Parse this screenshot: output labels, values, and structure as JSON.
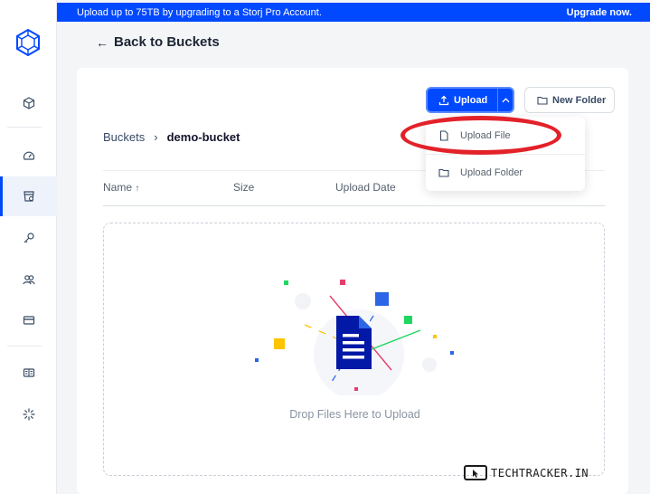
{
  "banner": {
    "message": "Upload up to 75TB by upgrading to a Storj Pro Account.",
    "cta": "Upgrade now."
  },
  "nav": {
    "back_label": "Back to Buckets"
  },
  "sidebar": {
    "logo": "storj-logo-icon",
    "items": [
      {
        "name": "dashboard",
        "icon": "cube-icon"
      },
      {
        "name": "usage",
        "icon": "gauge-icon"
      },
      {
        "name": "buckets",
        "icon": "bucket-icon",
        "active": true
      },
      {
        "name": "access",
        "icon": "key-icon"
      },
      {
        "name": "team",
        "icon": "users-icon"
      },
      {
        "name": "billing",
        "icon": "card-icon"
      },
      {
        "name": "resources",
        "icon": "book-icon"
      },
      {
        "name": "settings",
        "icon": "spark-icon"
      }
    ]
  },
  "toolbar": {
    "upload_label": "Upload",
    "new_folder_label": "New Folder"
  },
  "breadcrumb": {
    "root": "Buckets",
    "separator": "›",
    "current": "demo-bucket"
  },
  "upload_menu": {
    "items": [
      {
        "label": "Upload File",
        "icon": "file-icon"
      },
      {
        "label": "Upload Folder",
        "icon": "folder-icon"
      }
    ]
  },
  "table": {
    "columns": [
      "Name",
      "Size",
      "Upload Date"
    ],
    "sort_indicator": "↑"
  },
  "dropzone": {
    "text": "Drop Files Here to Upload"
  },
  "watermark": {
    "text": "TECHTRACKER.IN"
  },
  "colors": {
    "accent": "#0149ff",
    "highlight": "#e32129"
  }
}
